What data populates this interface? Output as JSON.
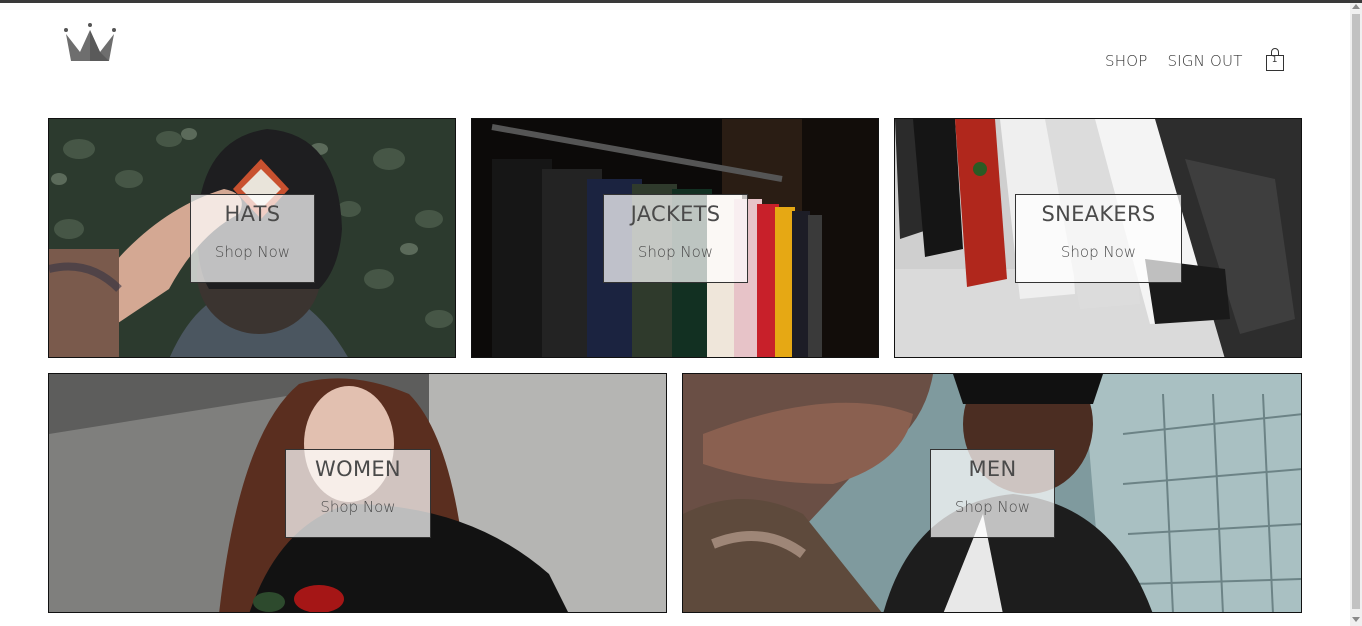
{
  "header": {
    "logo_icon": "crown-icon",
    "nav": [
      {
        "label": "SHOP"
      },
      {
        "label": "SIGN OUT"
      }
    ],
    "cart": {
      "icon": "shopping-bag-icon",
      "count": "1"
    }
  },
  "categories": [
    {
      "title": "HATS",
      "cta": "Shop Now"
    },
    {
      "title": "JACKETS",
      "cta": "Shop Now"
    },
    {
      "title": "SNEAKERS",
      "cta": "Shop Now"
    },
    {
      "title": "WOMEN",
      "cta": "Shop Now"
    },
    {
      "title": "MEN",
      "cta": "Shop Now"
    }
  ],
  "colors": {
    "text": "#333333",
    "overlay": "#ffffffb8",
    "border": "#111111"
  }
}
